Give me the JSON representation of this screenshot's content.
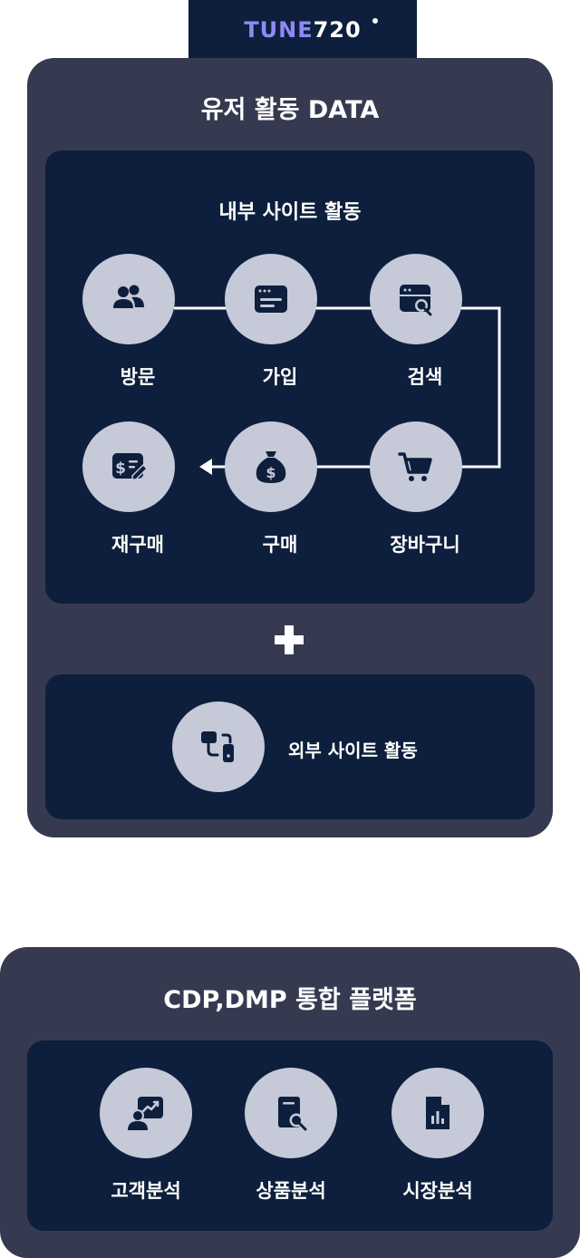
{
  "brand": {
    "logo_accent": "TUNE",
    "logo_rest": "720",
    "accent_color": "#8f89f7"
  },
  "user_activity": {
    "title": "유저 활동 DATA",
    "internal": {
      "title": "내부 사이트 활동",
      "steps": [
        {
          "label": "방문",
          "icon": "users-icon"
        },
        {
          "label": "가입",
          "icon": "browser-form-icon"
        },
        {
          "label": "검색",
          "icon": "browser-search-icon"
        },
        {
          "label": "장바구니",
          "icon": "shopping-cart-icon"
        },
        {
          "label": "구매",
          "icon": "money-bag-icon"
        },
        {
          "label": "재구매",
          "icon": "invoice-edit-icon"
        }
      ]
    },
    "external": {
      "label": "외부 사이트 활동",
      "icon": "device-link-icon"
    }
  },
  "platform": {
    "title": "CDP,DMP 통합 플랫폼",
    "items": [
      {
        "label": "고객분석",
        "icon": "customer-analysis-icon"
      },
      {
        "label": "상품분석",
        "icon": "document-search-icon"
      },
      {
        "label": "시장분석",
        "icon": "report-chart-icon"
      }
    ]
  },
  "colors": {
    "panel": "#363a50",
    "inner": "#0d1f3c",
    "node": "#c5c9d8",
    "icon": "#0d1f3c"
  }
}
